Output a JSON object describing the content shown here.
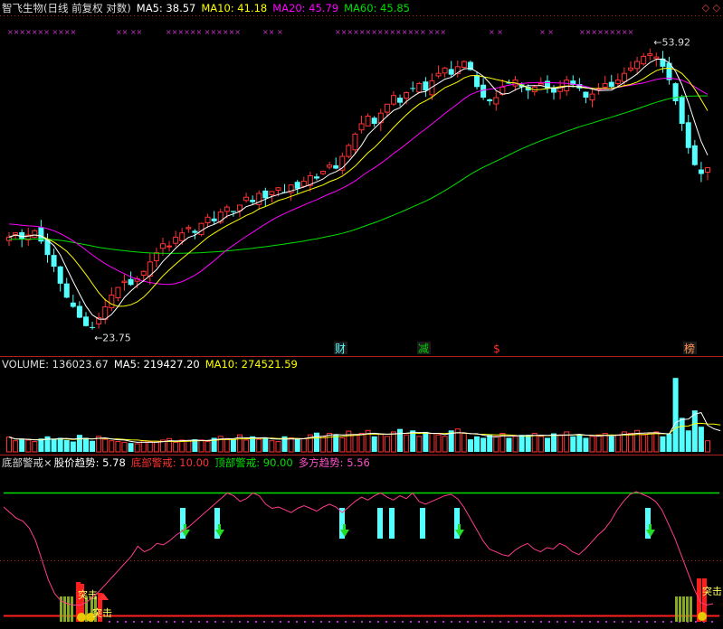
{
  "header": {
    "stock": "智飞生物(日线 前复权 对数)",
    "ma5": "MA5: 38.57",
    "ma10": "MA10: 41.18",
    "ma20": "MA20: 45.79",
    "ma60": "MA60: 45.85",
    "corner_icons": "◇ ◇"
  },
  "colors": {
    "up": "#ff3232",
    "down": "#54ffff",
    "ma5": "#ffffff",
    "ma10": "#ffff00",
    "ma20": "#ff00ff",
    "ma60": "#00e000",
    "signal": "#ff3c8c",
    "top_line": "#00dd00",
    "bottom_line": "#ff2020"
  },
  "price_panel": {
    "markers": [
      "××××××× ××××",
      "×× ××",
      "×××××× ××××××",
      "×× ×",
      "×××××××××××××××",
      "×××",
      "× ×",
      "× ×",
      "×××××××××"
    ],
    "labels": {
      "high": "53.92",
      "low": "23.75"
    },
    "event_badges": [
      "财",
      "减",
      "$",
      "榜"
    ],
    "chart_data": {
      "type": "candlestick",
      "title": "智飞生物(日线 前复权 对数)",
      "scale": "log",
      "y_range": [
        22.5,
        58
      ],
      "high_label": 53.92,
      "low_label": 23.75,
      "close": [
        31.2,
        31.6,
        31.0,
        31.4,
        31.8,
        30.8,
        29.6,
        28.6,
        27.2,
        26.1,
        25.4,
        24.6,
        24.0,
        23.9,
        24.6,
        25.4,
        26.3,
        26.9,
        27.4,
        27.1,
        27.6,
        28.2,
        29.0,
        29.8,
        30.6,
        30.4,
        31.2,
        31.6,
        32.1,
        31.6,
        32.5,
        33.1,
        32.7,
        33.6,
        34.1,
        33.6,
        34.3,
        35.1,
        34.6,
        35.5,
        35.0,
        35.7,
        36.1,
        35.6,
        36.4,
        36.0,
        36.8,
        37.4,
        37.1,
        37.9,
        38.6,
        38.2,
        39.6,
        40.9,
        42.3,
        43.6,
        44.6,
        43.6,
        45.0,
        46.2,
        47.4,
        46.4,
        47.8,
        48.4,
        49.1,
        48.1,
        49.5,
        50.6,
        51.4,
        50.4,
        51.6,
        52.4,
        51.1,
        48.6,
        47.1,
        46.6,
        47.1,
        48.6,
        49.1,
        49.6,
        48.6,
        48.1,
        48.6,
        49.1,
        48.4,
        47.8,
        48.6,
        49.6,
        48.9,
        48.4,
        47.1,
        47.6,
        48.4,
        49.1,
        48.6,
        49.6,
        50.6,
        51.4,
        52.4,
        53.2,
        53.6,
        53.1,
        51.6,
        49.6,
        46.6,
        43.6,
        40.6,
        38.6,
        37.6,
        38.3
      ],
      "ma5": 38.57,
      "ma10": 41.18,
      "ma20": 45.79,
      "ma60": 45.85
    }
  },
  "volume_panel": {
    "label_volume": "VOLUME: 136023.67",
    "label_ma5": "MA5: 219427.20",
    "label_ma10": "MA10: 274521.59",
    "chart_data": {
      "type": "bar",
      "volume": 136023.67,
      "ma5": 219427.2,
      "ma10": 274521.59,
      "values": [
        20,
        15,
        17,
        16,
        14,
        18,
        21,
        17,
        19,
        16,
        14,
        23,
        19,
        15,
        21,
        17,
        15,
        14,
        13,
        12,
        11,
        15,
        14,
        13,
        16,
        18,
        13,
        16,
        15,
        17,
        16,
        14,
        19,
        21,
        18,
        17,
        23,
        16,
        21,
        17,
        19,
        15,
        14,
        21,
        19,
        17,
        18,
        23,
        26,
        21,
        25,
        23,
        19,
        28,
        23,
        25,
        29,
        21,
        24,
        21,
        27,
        31,
        23,
        29,
        21,
        27,
        25,
        23,
        21,
        29,
        31,
        25,
        17,
        21,
        19,
        23,
        21,
        25,
        19,
        21,
        23,
        23,
        25,
        21,
        19,
        25,
        23,
        27,
        21,
        23,
        19,
        21,
        23,
        25,
        21,
        23,
        27,
        25,
        29,
        23,
        25,
        27,
        21,
        25,
        100,
        46,
        29,
        56,
        34,
        15,
        22,
        16
      ],
      "y_range": [
        0,
        110
      ]
    }
  },
  "indicator_panel": {
    "label_title": "底部警戒×",
    "label_trend": "股价趋势: 5.78",
    "label_bottom": "底部警戒: 10.00",
    "label_top": "顶部警戒: 90.00",
    "label_multi": "多方趋势: 5.56",
    "attack_labels": [
      "突击",
      "突击",
      "突击"
    ],
    "chart_data": {
      "type": "line",
      "top_threshold": 90,
      "bottom_threshold": 10,
      "y_range": [
        0,
        100
      ],
      "trend": [
        80,
        76,
        72,
        70,
        65,
        56,
        42,
        28,
        18,
        13,
        11,
        10,
        10,
        12,
        16,
        20,
        25,
        30,
        35,
        40,
        45,
        52,
        48,
        50,
        54,
        53,
        56,
        60,
        63,
        66,
        70,
        74,
        78,
        82,
        86,
        90,
        88,
        84,
        86,
        90,
        88,
        82,
        79,
        80,
        78,
        76,
        79,
        81,
        79,
        77,
        80,
        82,
        80,
        76,
        80,
        84,
        87,
        85,
        88,
        90,
        87,
        85,
        88,
        86,
        90,
        84,
        82,
        84,
        86,
        88,
        89,
        86,
        80,
        72,
        64,
        56,
        50,
        48,
        46,
        45,
        49,
        52,
        54,
        50,
        48,
        51,
        50,
        54,
        52,
        48,
        46,
        50,
        55,
        60,
        64,
        70,
        78,
        84,
        89,
        91,
        89,
        87,
        84,
        78,
        68,
        58,
        46,
        34,
        22,
        12,
        10,
        11
      ]
    }
  }
}
